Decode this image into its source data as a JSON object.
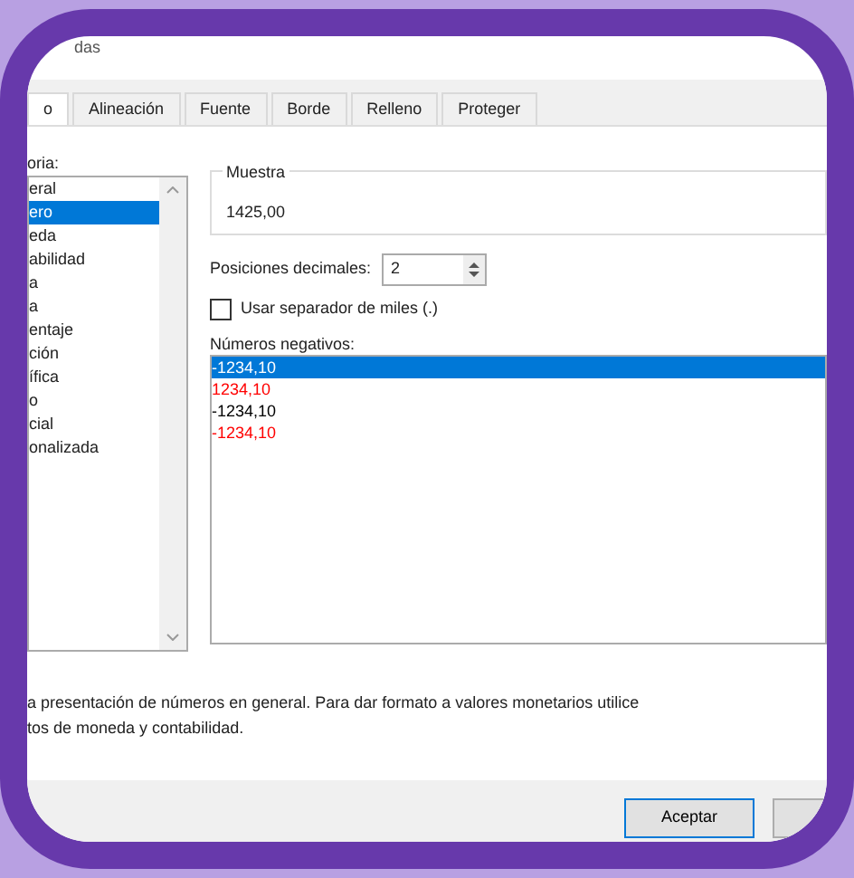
{
  "window": {
    "title": "das"
  },
  "tabs": [
    {
      "label": "o",
      "selected": true
    },
    {
      "label": "Alineación",
      "selected": false
    },
    {
      "label": "Fuente",
      "selected": false
    },
    {
      "label": "Borde",
      "selected": false
    },
    {
      "label": "Relleno",
      "selected": false
    },
    {
      "label": "Proteger",
      "selected": false
    }
  ],
  "category": {
    "label": "oria:",
    "items": [
      {
        "label": "eral",
        "selected": false
      },
      {
        "label": "ero",
        "selected": true
      },
      {
        "label": "eda",
        "selected": false
      },
      {
        "label": "abilidad",
        "selected": false
      },
      {
        "label": "a",
        "selected": false
      },
      {
        "label": "a",
        "selected": false
      },
      {
        "label": "entaje",
        "selected": false
      },
      {
        "label": "ción",
        "selected": false
      },
      {
        "label": "ífica",
        "selected": false
      },
      {
        "label": "o",
        "selected": false
      },
      {
        "label": "cial",
        "selected": false
      },
      {
        "label": "onalizada",
        "selected": false
      }
    ]
  },
  "sample": {
    "label": "Muestra",
    "value": "1425,00"
  },
  "decimals": {
    "label": "Posiciones decimales:",
    "value": "2"
  },
  "thousands": {
    "label": "Usar separador de miles (.)",
    "checked": false
  },
  "negatives": {
    "label": "Números negativos:",
    "items": [
      {
        "label": "-1234,10",
        "selected": true
      },
      {
        "label": "1234,10",
        "selected": false,
        "red": true
      },
      {
        "label": "-1234,10",
        "selected": false,
        "red": false
      },
      {
        "label": "-1234,10",
        "selected": false,
        "red": true
      }
    ]
  },
  "description_lines": [
    "a presentación de números en general. Para dar formato a valores monetarios utilice",
    "tos de moneda y contabilidad."
  ],
  "buttons": [
    "Aceptar"
  ]
}
